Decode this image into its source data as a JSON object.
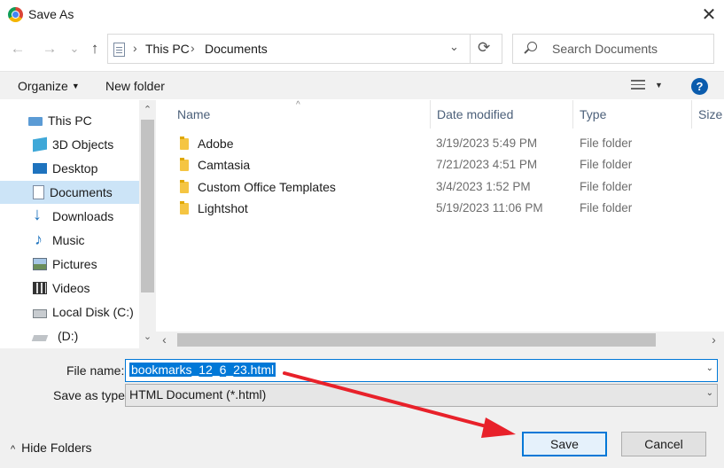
{
  "window": {
    "title": "Save As",
    "close_glyph": "✕",
    "app_icon": "chrome-icon"
  },
  "navigation": {
    "back_glyph": "←",
    "forward_glyph": "→",
    "recent_glyph": "⌄",
    "up_glyph": "↑",
    "breadcrumb": [
      "This PC",
      "Documents"
    ],
    "breadcrumb_sep": "›",
    "dropdown_glyph": "⌄",
    "refresh_glyph": "⟳",
    "search_placeholder": "Search Documents"
  },
  "toolbar": {
    "organize": "Organize",
    "organize_caret": "▼",
    "new_folder": "New folder",
    "view_caret": "▼",
    "help": "?"
  },
  "nav_pane": {
    "items": [
      {
        "label": "This PC",
        "icon": "pc-icon"
      },
      {
        "label": "3D Objects",
        "icon": "3d-objects-icon"
      },
      {
        "label": "Desktop",
        "icon": "desktop-icon"
      },
      {
        "label": "Documents",
        "icon": "documents-icon",
        "selected": true
      },
      {
        "label": "Downloads",
        "icon": "downloads-icon"
      },
      {
        "label": "Music",
        "icon": "music-icon"
      },
      {
        "label": "Pictures",
        "icon": "pictures-icon"
      },
      {
        "label": "Videos",
        "icon": "videos-icon"
      },
      {
        "label": "Local Disk (C:)",
        "icon": "local-disk-icon"
      },
      {
        "label": "(D:)",
        "icon": "drive-icon"
      }
    ],
    "scroll_up": "⌃",
    "scroll_down": "⌄"
  },
  "file_list": {
    "columns": [
      "Name",
      "Date modified",
      "Type",
      "Size"
    ],
    "sort_glyph": "^",
    "rows": [
      {
        "name": "Adobe",
        "date": "3/19/2023 5:49 PM",
        "type": "File folder"
      },
      {
        "name": "Camtasia",
        "date": "7/21/2023 4:51 PM",
        "type": "File folder"
      },
      {
        "name": "Custom Office Templates",
        "date": "3/4/2023 1:52 PM",
        "type": "File folder"
      },
      {
        "name": "Lightshot",
        "date": "5/19/2023 11:06 PM",
        "type": "File folder"
      }
    ],
    "hscroll_left": "‹",
    "hscroll_right": "›"
  },
  "form": {
    "file_name_label": "File name:",
    "file_name_value": "bookmarks_12_6_23.html",
    "save_type_label": "Save as type:",
    "save_type_value": "HTML Document (*.html)",
    "chev": "⌄"
  },
  "footer": {
    "hide_folders": "Hide Folders",
    "up_glyph": "^",
    "save": "Save",
    "cancel": "Cancel"
  },
  "annotation": {
    "arrow_color": "#e8212a"
  }
}
